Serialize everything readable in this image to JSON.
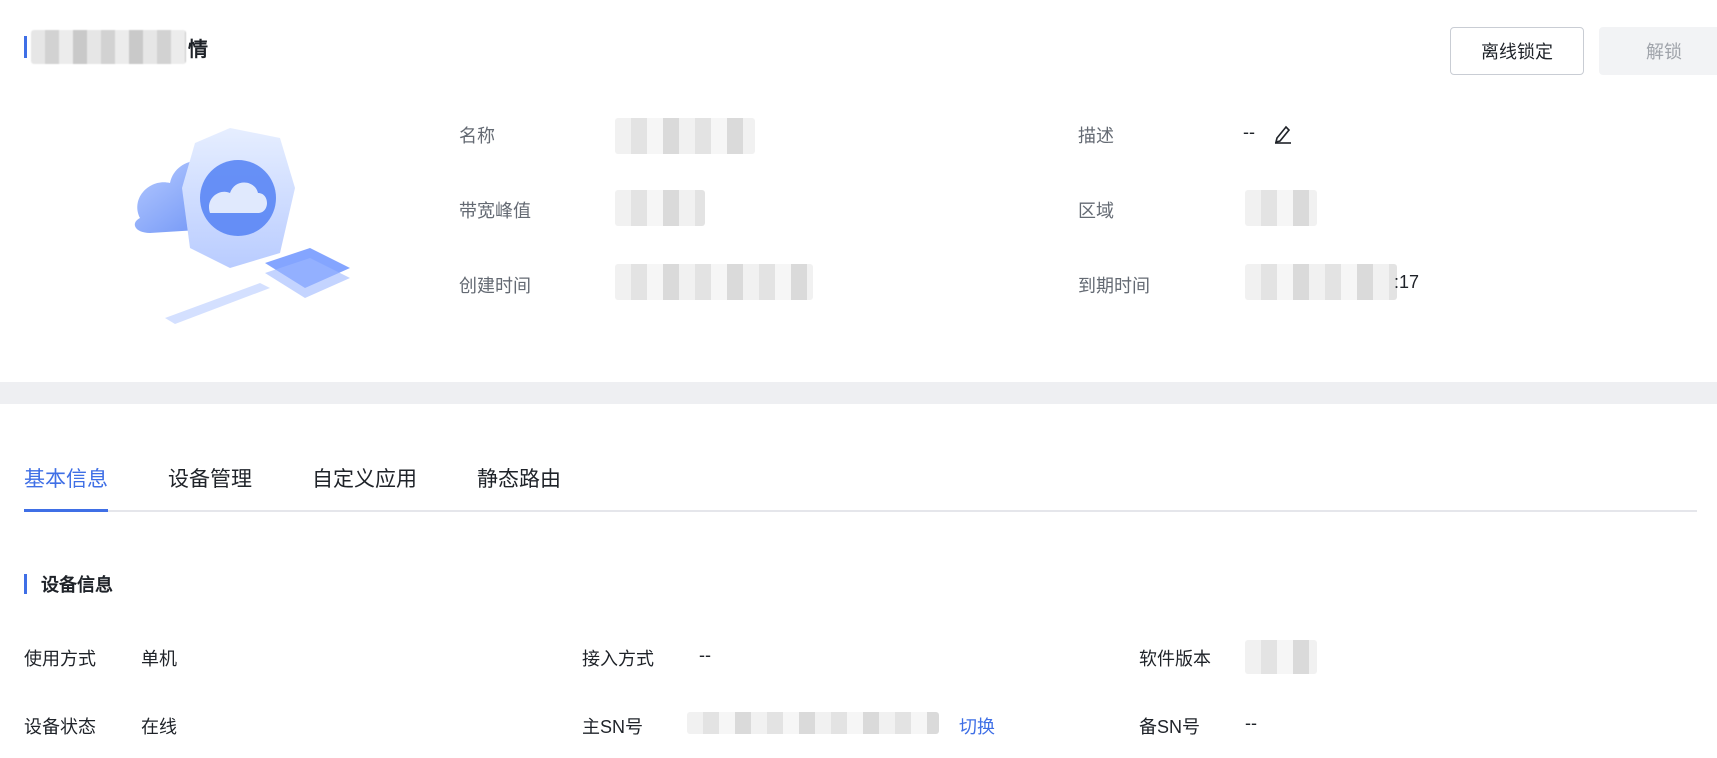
{
  "header": {
    "title_visible_tail": "情",
    "lock_button": "离线锁定",
    "unlock_button": "解锁"
  },
  "summary": {
    "name_label": "名称",
    "bandwidth_label": "带宽峰值",
    "created_label": "创建时间",
    "description_label": "描述",
    "description_value": "--",
    "region_label": "区域",
    "expire_label": "到期时间",
    "expire_visible_tail": ":17"
  },
  "tabs": [
    {
      "label": "基本信息",
      "active": true
    },
    {
      "label": "设备管理",
      "active": false
    },
    {
      "label": "自定义应用",
      "active": false
    },
    {
      "label": "静态路由",
      "active": false
    }
  ],
  "device_info": {
    "section_title": "设备信息",
    "usage_label": "使用方式",
    "usage_value": "单机",
    "access_label": "接入方式",
    "access_value": "--",
    "software_label": "软件版本",
    "status_label": "设备状态",
    "status_value": "在线",
    "main_sn_label": "主SN号",
    "switch_link": "切换",
    "backup_sn_label": "备SN号",
    "backup_sn_value": "--"
  },
  "colors": {
    "accent": "#3f6fe6",
    "divider": "#eeeff2",
    "label_gray": "#646a73"
  },
  "icons": [
    "edit-icon",
    "cloud-device-illustration"
  ]
}
